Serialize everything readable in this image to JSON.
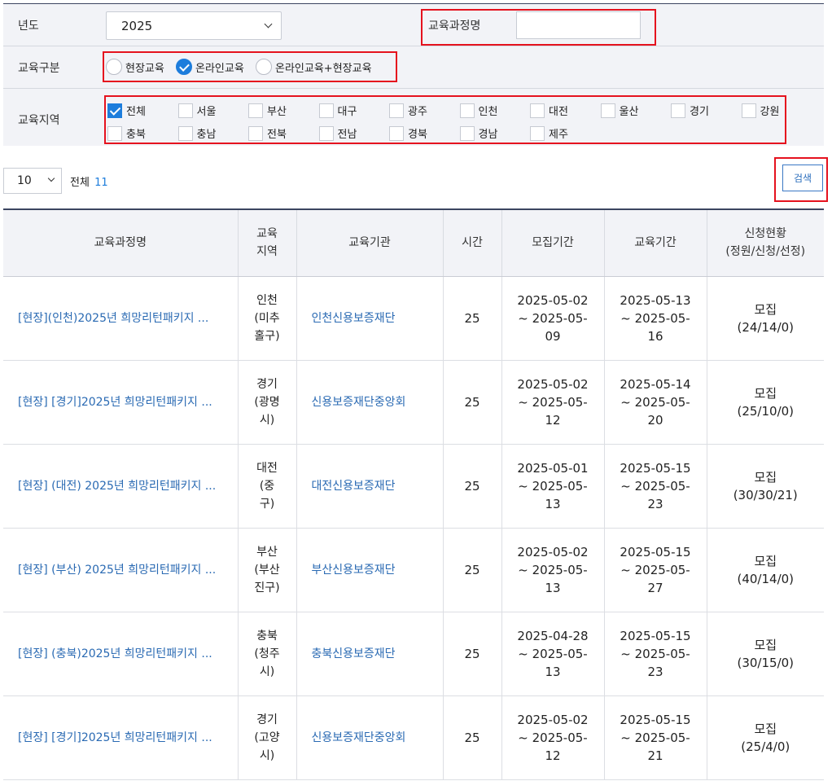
{
  "filter": {
    "year_label": "년도",
    "year_value": "2025",
    "course_name_label": "교육과정명",
    "course_name_value": "",
    "type_label": "교육구분",
    "type_options": [
      {
        "label": "현장교육",
        "selected": false
      },
      {
        "label": "온라인교육",
        "selected": true
      },
      {
        "label": "온라인교육+현장교육",
        "selected": false
      }
    ],
    "region_label": "교육지역",
    "regions": [
      {
        "label": "전체",
        "checked": true
      },
      {
        "label": "서울",
        "checked": false
      },
      {
        "label": "부산",
        "checked": false
      },
      {
        "label": "대구",
        "checked": false
      },
      {
        "label": "광주",
        "checked": false
      },
      {
        "label": "인천",
        "checked": false
      },
      {
        "label": "대전",
        "checked": false
      },
      {
        "label": "울산",
        "checked": false
      },
      {
        "label": "경기",
        "checked": false
      },
      {
        "label": "강원",
        "checked": false
      },
      {
        "label": "충북",
        "checked": false
      },
      {
        "label": "충남",
        "checked": false
      },
      {
        "label": "전북",
        "checked": false
      },
      {
        "label": "전남",
        "checked": false
      },
      {
        "label": "경북",
        "checked": false
      },
      {
        "label": "경남",
        "checked": false
      },
      {
        "label": "제주",
        "checked": false
      }
    ]
  },
  "toolbar": {
    "page_size": "10",
    "total_label": "전체",
    "total_count": "11",
    "search_label": "검색"
  },
  "table": {
    "columns": [
      "교육과정명",
      "교육\n지역",
      "교육기관",
      "시간",
      "모집기간",
      "교육기간",
      "신청현황\n(정원/신청/선정)"
    ],
    "rows": [
      {
        "course": "[현장](인천)2025년 희망리턴패키지 ...",
        "region": "인천\n(미추\n홀구)",
        "org": "인천신용보증재단",
        "hours": "25",
        "recruit": "2025-05-02 ~ 2025-05-09",
        "edu": "2025-05-13 ~ 2025-05-16",
        "status": "모집\n(24/14/0)"
      },
      {
        "course": "[현장] [경기]2025년 희망리턴패키지 ...",
        "region": "경기\n(광명\n시)",
        "org": "신용보증재단중앙회",
        "hours": "25",
        "recruit": "2025-05-02 ~ 2025-05-12",
        "edu": "2025-05-14 ~ 2025-05-20",
        "status": "모집\n(25/10/0)"
      },
      {
        "course": "[현장] (대전) 2025년 희망리턴패키지 ...",
        "region": "대전\n(중\n구)",
        "org": "대전신용보증재단",
        "hours": "25",
        "recruit": "2025-05-01 ~ 2025-05-13",
        "edu": "2025-05-15 ~ 2025-05-23",
        "status": "모집\n(30/30/21)"
      },
      {
        "course": "[현장] (부산) 2025년 희망리턴패키지 ...",
        "region": "부산\n(부산\n진구)",
        "org": "부산신용보증재단",
        "hours": "25",
        "recruit": "2025-05-02 ~ 2025-05-13",
        "edu": "2025-05-15 ~ 2025-05-27",
        "status": "모집\n(40/14/0)"
      },
      {
        "course": "[현장] (충북)2025년 희망리턴패키지 ...",
        "region": "충북\n(청주\n시)",
        "org": "충북신용보증재단",
        "hours": "25",
        "recruit": "2025-04-28 ~ 2025-05-13",
        "edu": "2025-05-15 ~ 2025-05-23",
        "status": "모집\n(30/15/0)"
      },
      {
        "course": "[현장] [경기]2025년 희망리턴패키지 ...",
        "region": "경기\n(고양\n시)",
        "org": "신용보증재단중앙회",
        "hours": "25",
        "recruit": "2025-05-02 ~ 2025-05-12",
        "edu": "2025-05-15 ~ 2025-05-21",
        "status": "모집\n(25/4/0)"
      }
    ]
  }
}
